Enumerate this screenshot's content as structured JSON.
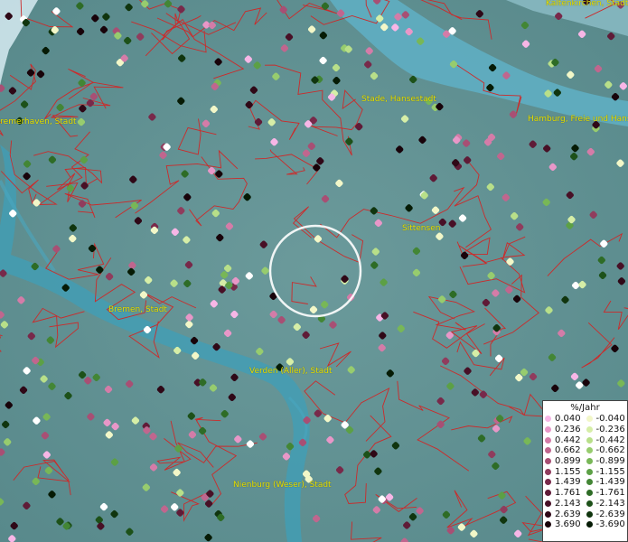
{
  "map": {
    "cities": [
      {
        "name": "Kaltenkirchen, Stadt",
        "id": "kaltenkirchen"
      },
      {
        "name": "Bremerhaven, Stadt",
        "id": "bremerhaven"
      },
      {
        "name": "Stade, Hansestadt",
        "id": "stade"
      },
      {
        "name": "Hamburg, Freie und Hansestadt",
        "id": "hamburg"
      },
      {
        "name": "Sittensen",
        "id": "sittensen"
      },
      {
        "name": "Bremen, Stadt",
        "id": "bremen"
      },
      {
        "name": "Verden (Aller), Stadt",
        "id": "verden"
      },
      {
        "name": "Nienburg (Weser), Stadt",
        "id": "nienburg"
      }
    ],
    "colors": {
      "water": "#9fc7d2",
      "river": "#41a0b9",
      "land": "#5e8f91",
      "boundaries": "#cc2a2a",
      "selection_ring": "#ffffff",
      "label": "#e8e000"
    }
  },
  "legend": {
    "title": "%/Jahr",
    "positive": [
      {
        "label": "0.040",
        "color": "#f7b6e6"
      },
      {
        "label": "0.236",
        "color": "#e897c8"
      },
      {
        "label": "0.442",
        "color": "#d47ca8"
      },
      {
        "label": "0.662",
        "color": "#c0668e"
      },
      {
        "label": "0.899",
        "color": "#a84f74"
      },
      {
        "label": "1.155",
        "color": "#903c5d"
      },
      {
        "label": "1.439",
        "color": "#78294a"
      },
      {
        "label": "1.761",
        "color": "#5f1b37"
      },
      {
        "label": "2.143",
        "color": "#481026"
      },
      {
        "label": "2.639",
        "color": "#2f0817"
      },
      {
        "label": "3.690",
        "color": "#18030a"
      }
    ],
    "negative": [
      {
        "label": "-0.040",
        "color": "#f2f7c8"
      },
      {
        "label": "-0.236",
        "color": "#d6eea7"
      },
      {
        "label": "-0.442",
        "color": "#b8df89"
      },
      {
        "label": "-0.662",
        "color": "#97cc6e"
      },
      {
        "label": "-0.899",
        "color": "#78b757"
      },
      {
        "label": "-1.155",
        "color": "#5ca045"
      },
      {
        "label": "-1.439",
        "color": "#438635"
      },
      {
        "label": "-1.761",
        "color": "#2e6c26"
      },
      {
        "label": "-2.143",
        "color": "#1d5119"
      },
      {
        "label": "-2.639",
        "color": "#10350e"
      },
      {
        "label": "-3.690",
        "color": "#061b05"
      }
    ]
  }
}
